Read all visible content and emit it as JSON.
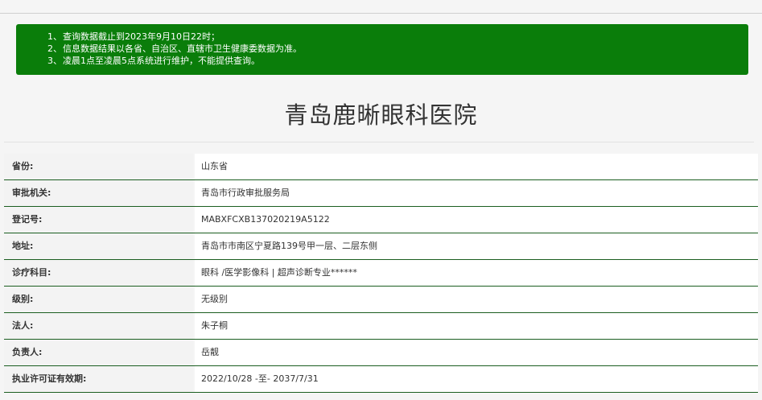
{
  "notice": {
    "items": [
      {
        "num": "1、",
        "text": "查询数据截止到2023年9月10日22时；"
      },
      {
        "num": "2、",
        "text": "信息数据结果以各省、自治区、直辖市卫生健康委数据为准。"
      },
      {
        "num": "3、",
        "text": "凌晨1点至凌晨5点系统进行维护，不能提供查询。"
      }
    ],
    "bg_color": "#0a7d0a"
  },
  "page_title": "青岛鹿晰眼科医院",
  "info_rows": [
    {
      "label": "省份:",
      "value": "山东省"
    },
    {
      "label": "审批机关:",
      "value": "青岛市行政审批服务局"
    },
    {
      "label": "登记号:",
      "value": "MABXFCXB137020219A5122"
    },
    {
      "label": "地址:",
      "value": "青岛市市南区宁夏路139号甲一层、二层东侧"
    },
    {
      "label": "诊疗科目:",
      "value": "眼科 /医学影像科 | 超声诊断专业******"
    },
    {
      "label": "级别:",
      "value": "无级别"
    },
    {
      "label": "法人:",
      "value": "朱子桐"
    },
    {
      "label": "负责人:",
      "value": "岳靓"
    },
    {
      "label": "执业许可证有效期:",
      "value": "2022/10/28 -至- 2037/7/31"
    }
  ],
  "colors": {
    "row_divider": "#1b5e20",
    "label_bg": "#f3f3f3",
    "value_bg": "#ffffff"
  }
}
